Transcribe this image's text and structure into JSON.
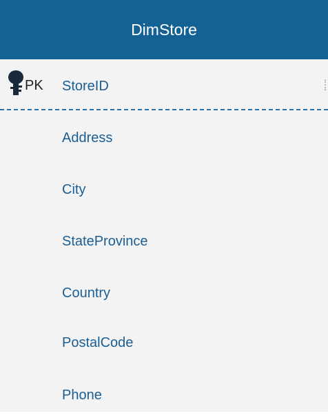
{
  "entity": {
    "name": "DimStore",
    "primary_key": {
      "marker": "PK",
      "icon": "key-icon",
      "field": "StoreID"
    },
    "fields": [
      "Address",
      "City",
      "StateProvince",
      "Country",
      "PostalCode",
      "Phone"
    ]
  },
  "colors": {
    "header_bg": "#146194",
    "body_bg": "#f3f3f3",
    "field_text": "#1b5e93",
    "divider": "#2a6ea6"
  }
}
